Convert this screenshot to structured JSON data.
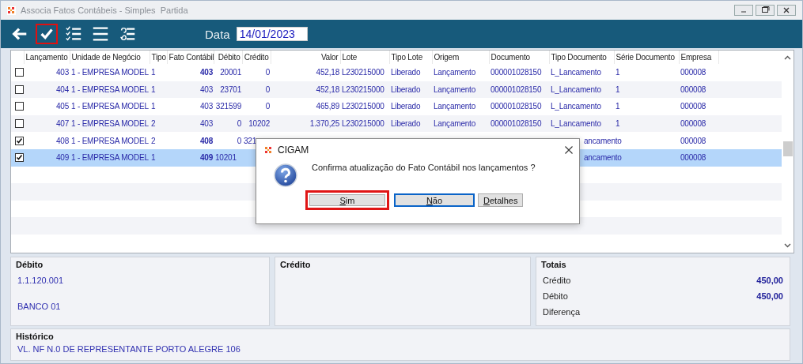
{
  "window": {
    "title": "Associa Fatos Contábeis - Simples  Partida"
  },
  "toolbar": {
    "buttons": [
      {
        "kind": "back",
        "highlighted": false
      },
      {
        "kind": "check",
        "highlighted": true
      },
      {
        "kind": "checklist",
        "highlighted": false
      },
      {
        "kind": "lines",
        "highlighted": false
      },
      {
        "kind": "swap-list",
        "highlighted": false
      }
    ],
    "date_label": "Data",
    "date_value": "14/01/2023"
  },
  "table": {
    "columns": [
      "Lançamento",
      "Unidade de Negócio",
      "Tipo",
      "Fato Contábil",
      "Débito",
      "Crédito",
      "Valor",
      "Lote",
      "Tipo Lote",
      "Origem",
      "Documento",
      "Tipo Documento",
      "Série Documento",
      "Empresa"
    ],
    "rows": [
      {
        "checked": false,
        "selected": false,
        "emphasized": true,
        "cells": [
          "403",
          "1 - EMPRESA MODEL",
          "1",
          "403",
          "20001",
          "0",
          "452,18",
          "L230215000",
          "Liberado",
          "Lançamento",
          "000001028150",
          "L_Lancamento",
          "1",
          "000008"
        ]
      },
      {
        "checked": false,
        "selected": false,
        "emphasized": false,
        "cells": [
          "404",
          "1 - EMPRESA MODEL",
          "1",
          "403",
          "23701",
          "0",
          "452,18",
          "L230215000",
          "Liberado",
          "Lançamento",
          "000001028150",
          "L_Lancamento",
          "1",
          "000008"
        ]
      },
      {
        "checked": false,
        "selected": false,
        "emphasized": false,
        "cells": [
          "405",
          "1 - EMPRESA MODEL",
          "1",
          "403",
          "321599",
          "0",
          "465,89",
          "L230215000",
          "Liberado",
          "Lançamento",
          "000001028150",
          "L_Lancamento",
          "1",
          "000008"
        ]
      },
      {
        "checked": false,
        "selected": false,
        "emphasized": false,
        "cells": [
          "407",
          "1 - EMPRESA MODEL",
          "2",
          "403",
          "0",
          "10202",
          "1.370,25",
          "L230215000",
          "Liberado",
          "Lançamento",
          "000001028150",
          "L_Lancamento",
          "1",
          "000008"
        ]
      },
      {
        "checked": true,
        "selected": false,
        "emphasized": true,
        "cells": [
          "408",
          "1 - EMPRESA MODEL",
          "2",
          "408",
          "0",
          "321",
          null,
          null,
          null,
          null,
          null,
          "ancamento",
          null,
          "000008"
        ]
      },
      {
        "checked": true,
        "selected": true,
        "emphasized": true,
        "cells": [
          "409",
          "1 - EMPRESA MODEL",
          "1",
          "409",
          "10201",
          null,
          null,
          null,
          null,
          null,
          null,
          "ancamento",
          null,
          "000008"
        ]
      }
    ]
  },
  "dialog": {
    "title": "CIGAM",
    "message": "Confirma atualização do Fato Contábil nos lançamentos ?",
    "buttons": [
      {
        "label": "Sim",
        "highlighted": true,
        "focused": false
      },
      {
        "label": "Não",
        "highlighted": false,
        "focused": true
      },
      {
        "label": "Detalhes",
        "highlighted": false,
        "focused": false
      }
    ]
  },
  "debit_panel": {
    "title": "Débito",
    "lines": [
      "1.1.120.001",
      "BANCO 01"
    ]
  },
  "credit_panel": {
    "title": "Crédito"
  },
  "totals_panel": {
    "title": "Totais",
    "rows": [
      {
        "label": "Crédito",
        "value": "450,00"
      },
      {
        "label": "Débito",
        "value": "450,00"
      },
      {
        "label": "Diferença"
      }
    ]
  },
  "history_panel": {
    "title": "Histórico",
    "text": "VL. NF N.0 DE REPRESENTANTE PORTO ALEGRE 106"
  }
}
